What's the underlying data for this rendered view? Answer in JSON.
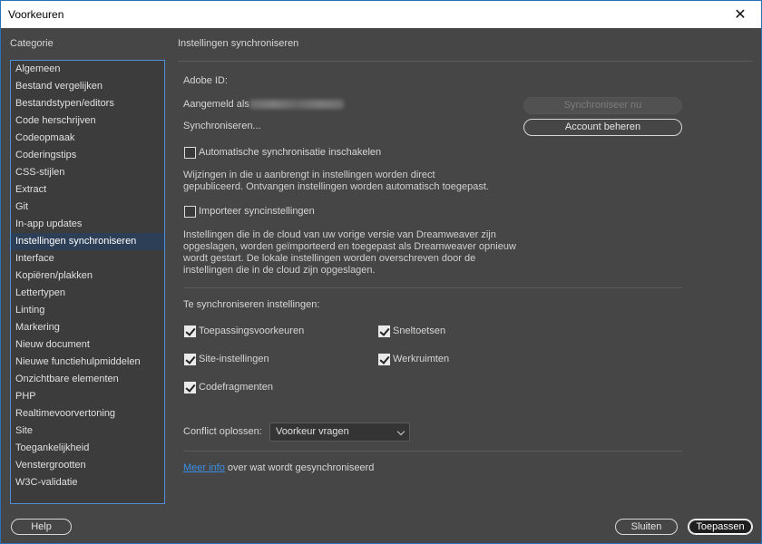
{
  "window": {
    "title": "Voorkeuren",
    "close_icon": "close-icon"
  },
  "sidebar": {
    "heading": "Categorie",
    "items": [
      {
        "label": "Algemeen"
      },
      {
        "label": "Bestand vergelijken"
      },
      {
        "label": "Bestandstypen/editors"
      },
      {
        "label": "Code herschrijven"
      },
      {
        "label": "Codeopmaak"
      },
      {
        "label": "Coderingstips"
      },
      {
        "label": "CSS-stijlen"
      },
      {
        "label": "Extract"
      },
      {
        "label": "Git"
      },
      {
        "label": "In-app updates"
      },
      {
        "label": "Instellingen synchroniseren",
        "selected": true
      },
      {
        "label": "Interface"
      },
      {
        "label": "Kopiëren/plakken"
      },
      {
        "label": "Lettertypen"
      },
      {
        "label": "Linting"
      },
      {
        "label": "Markering"
      },
      {
        "label": "Nieuw document"
      },
      {
        "label": "Nieuwe functiehulpmiddelen"
      },
      {
        "label": "Onzichtbare elementen"
      },
      {
        "label": "PHP"
      },
      {
        "label": "Realtimevoorvertoning"
      },
      {
        "label": "Site"
      },
      {
        "label": "Toegankelijkheid"
      },
      {
        "label": "Venstergrootten"
      },
      {
        "label": "W3C-validatie"
      }
    ]
  },
  "panel": {
    "heading": "Instellingen synchroniseren",
    "adobe_id_label": "Adobe ID:",
    "signed_in_label": "Aangemeld als",
    "syncing_label": "Synchroniseren...",
    "sync_now_button": "Synchroniseer nu",
    "manage_account_button": "Account beheren",
    "auto_sync": {
      "label": "Automatische synchronisatie inschakelen",
      "checked": false,
      "description_1": "Wijzingen in die u aanbrengt in instellingen worden direct",
      "description_2": "gepubliceerd. Ontvangen instellingen worden automatisch toegepast."
    },
    "import_sync": {
      "label": "Importeer syncinstellingen",
      "checked": false,
      "description_1": "Instellingen die in de cloud van uw vorige versie van Dreamweaver zijn",
      "description_2": "opgeslagen, worden geïmporteerd en toegepast als Dreamweaver opnieuw",
      "description_3": "wordt gestart. De lokale instellingen worden overschreven door de",
      "description_4": "instellingen die in de cloud zijn opgeslagen."
    },
    "sync_settings_heading": "Te synchroniseren instellingen:",
    "options": {
      "app_prefs": {
        "label": "Toepassingsvoorkeuren",
        "checked": true
      },
      "shortcuts": {
        "label": "Sneltoetsen",
        "checked": true
      },
      "site_settings": {
        "label": "Site-instellingen",
        "checked": true
      },
      "workspaces": {
        "label": "Werkruimten",
        "checked": true
      },
      "snippets": {
        "label": "Codefragmenten",
        "checked": true
      }
    },
    "conflict_label": "Conflict oplossen:",
    "conflict_value": "Voorkeur vragen",
    "more_info_link": "Meer info",
    "more_info_text": "over wat wordt gesynchroniseerd"
  },
  "footer": {
    "help_button": "Help",
    "close_button": "Sluiten",
    "apply_button": "Toepassen"
  }
}
